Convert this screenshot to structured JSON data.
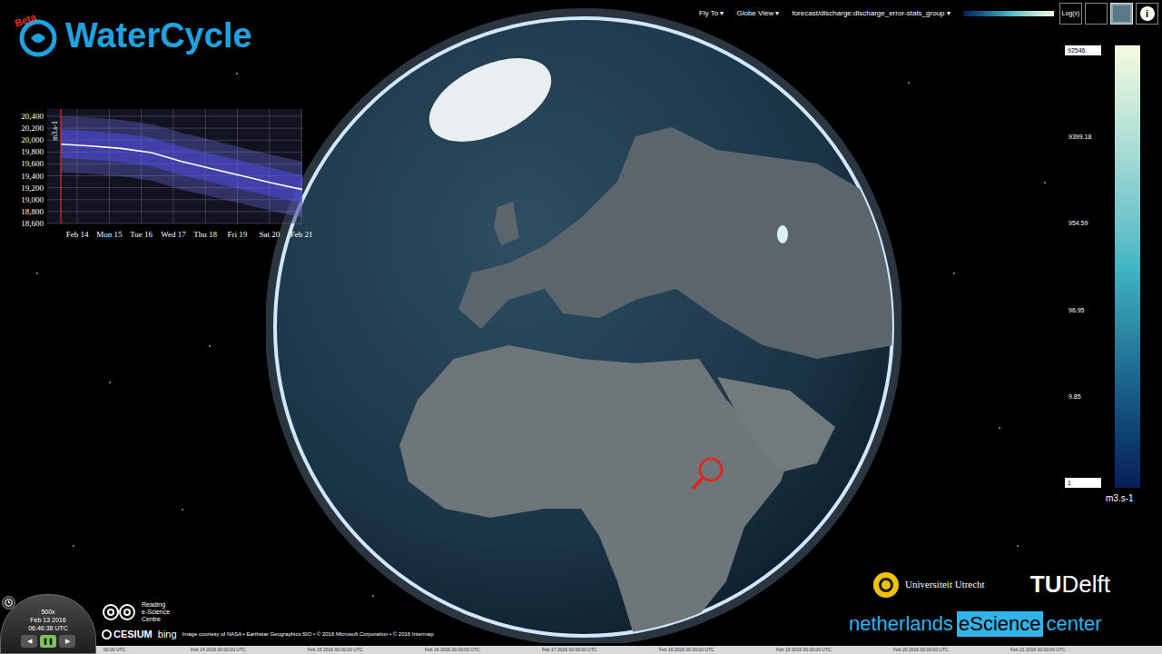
{
  "app": {
    "title": "WaterCycle",
    "badge": "Beta"
  },
  "toolbar": {
    "menus": [
      {
        "label": "Fly To",
        "arrow": "▾"
      },
      {
        "label": "Globe View",
        "arrow": "▾"
      },
      {
        "label": "forecast/discharge:discharge_error-stats_group",
        "arrow": "▾"
      }
    ],
    "buttons": [
      {
        "kind": "log",
        "label": "Log(x)",
        "selected": false
      },
      {
        "kind": "blank",
        "label": "",
        "selected": false
      },
      {
        "kind": "map",
        "label": "",
        "selected": true
      },
      {
        "kind": "info",
        "label": "i",
        "selected": false
      }
    ]
  },
  "legend": {
    "max": "92546.",
    "ticks": [
      "9399.18",
      "954.59",
      "96.95",
      "9.85"
    ],
    "min": "1",
    "unit": "m3.s-1"
  },
  "chart": {
    "unit": "m3.s-1",
    "y_ticks": [
      "20,400",
      "20,200",
      "20,000",
      "19,800",
      "19,600",
      "19,400",
      "19,200",
      "19,000",
      "18,800",
      "18,600"
    ],
    "x_ticks": [
      "Feb 14",
      "Mon 15",
      "Tue 16",
      "Wed 17",
      "Thu 18",
      "Fri 19",
      "Sat 20",
      "Feb 21"
    ],
    "series": {
      "p95": [
        20400,
        20380,
        20340,
        20270,
        20120,
        20000,
        19870,
        19750,
        19640
      ],
      "p75": [
        20180,
        20150,
        20110,
        20040,
        19890,
        19770,
        19650,
        19530,
        19410
      ],
      "median": [
        19930,
        19900,
        19860,
        19790,
        19640,
        19520,
        19400,
        19280,
        19170
      ],
      "p25": [
        19700,
        19670,
        19630,
        19560,
        19410,
        19290,
        19170,
        19050,
        18940
      ],
      "p5": [
        19460,
        19430,
        19390,
        19320,
        19170,
        19050,
        18930,
        18810,
        18700
      ]
    }
  },
  "clock": {
    "speed": "500x",
    "date": "Feb 13 2016",
    "time": "06:46:38 UTC",
    "buttons": [
      {
        "icon": "◀",
        "selected": false
      },
      {
        "icon": "❚❚",
        "selected": true
      },
      {
        "icon": "▶",
        "selected": false
      }
    ]
  },
  "timeline": {
    "labels": [
      "00:00 UTC",
      "Feb 14 2016 00:00:00 UTC",
      "Feb 15 2016 00:00:00 UTC",
      "Feb 16 2016 00:00:00 UTC",
      "Feb 17 2016 00:00:00 UTC",
      "Feb 18 2016 00:00:00 UTC",
      "Feb 19 2016 00:00:00 UTC",
      "Feb 20 2016 00:00:00 UTC",
      "Feb 21 2016 00:00:00 UTC"
    ]
  },
  "credits": {
    "reading": [
      "Reading",
      "e-Science",
      "Centre"
    ],
    "cesium": "CESIUM",
    "bing": "bing",
    "text": "Image courtesy of NASA • Earthstar Geographics SIO • © 2016 Microsoft Corporation • © 2016 Intermap"
  },
  "partners": {
    "utrecht": "Universiteit Utrecht",
    "tudelft": [
      "TU",
      "Delft"
    ],
    "escience": [
      "netherlands",
      "eScience",
      "center"
    ]
  }
}
